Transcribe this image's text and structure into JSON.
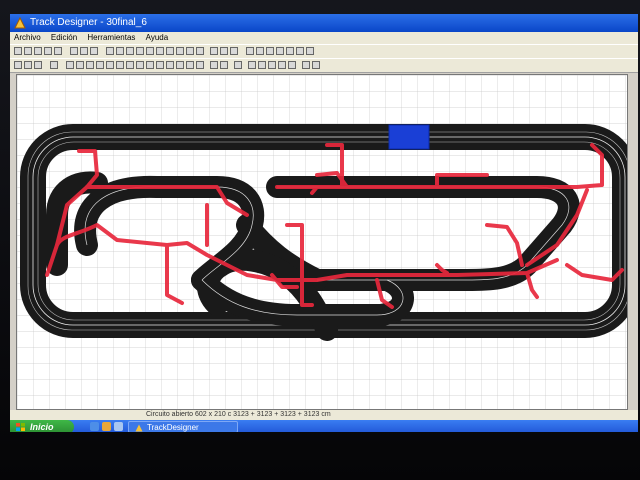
{
  "window": {
    "title": "Track Designer - 30final_6"
  },
  "menu": {
    "items": [
      "Archivo",
      "Edición",
      "Herramientas",
      "Ayuda"
    ]
  },
  "status": {
    "text": "Circuito abierto  602 x 210 c  3123 + 3123 + 3123 + 3123 cm"
  },
  "taskbar": {
    "start_label": "Inicio",
    "task_label": "TrackDesigner"
  },
  "colors": {
    "track": "#1a1a1a",
    "lane_line": "#ffffff",
    "wiring": "#e8283c",
    "selection": "#1a3fd6",
    "grid": "#c8c8c8"
  }
}
